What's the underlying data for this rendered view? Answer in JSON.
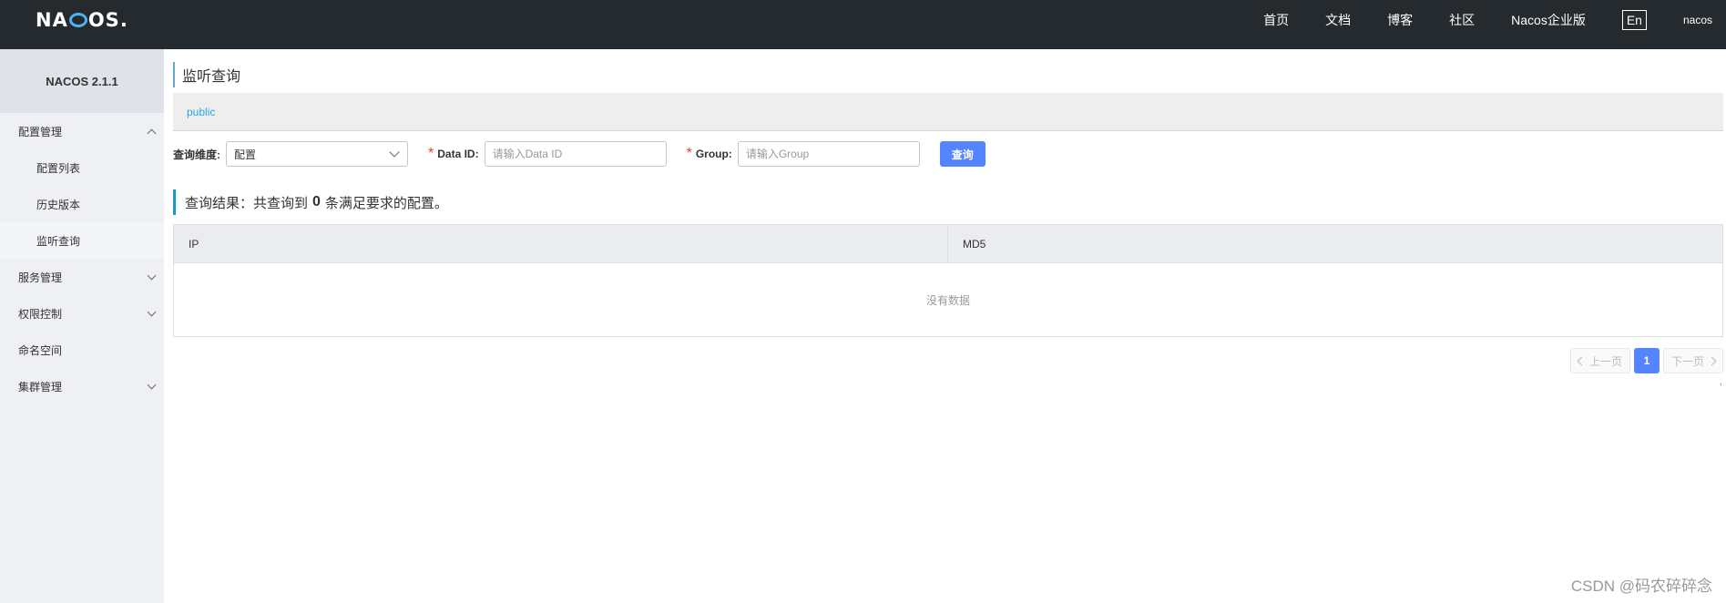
{
  "header": {
    "logo": {
      "left": "NA",
      "right": "OS",
      "dot": "."
    },
    "nav": [
      "首页",
      "文档",
      "博客",
      "社区",
      "Nacos企业版"
    ],
    "lang": "En",
    "user": "nacos"
  },
  "sidebar": {
    "version": "NACOS 2.1.1",
    "menu": {
      "config_group": "配置管理",
      "config_list": "配置列表",
      "history": "历史版本",
      "listener_query": "监听查询",
      "service": "服务管理",
      "auth": "权限控制",
      "namespace": "命名空间",
      "cluster": "集群管理"
    }
  },
  "main": {
    "title": "监听查询",
    "namespace": "public",
    "filter": {
      "dimension_label": "查询维度:",
      "dimension_value": "配置",
      "data_id_label": "Data ID:",
      "data_id_placeholder": "请输入Data ID",
      "group_label": "Group:",
      "group_placeholder": "请输入Group",
      "search_button": "查询",
      "required_mark": "*"
    },
    "result": {
      "prefix": "查询结果：共查询到",
      "count": "0",
      "suffix": "条满足要求的配置。"
    },
    "table": {
      "columns": [
        "IP",
        "MD5"
      ],
      "empty_text": "没有数据"
    },
    "pagination": {
      "prev": "上一页",
      "current": "1",
      "next": "下一页"
    }
  },
  "watermark": "CSDN @码农碎碎念",
  "stray_mark": ","
}
